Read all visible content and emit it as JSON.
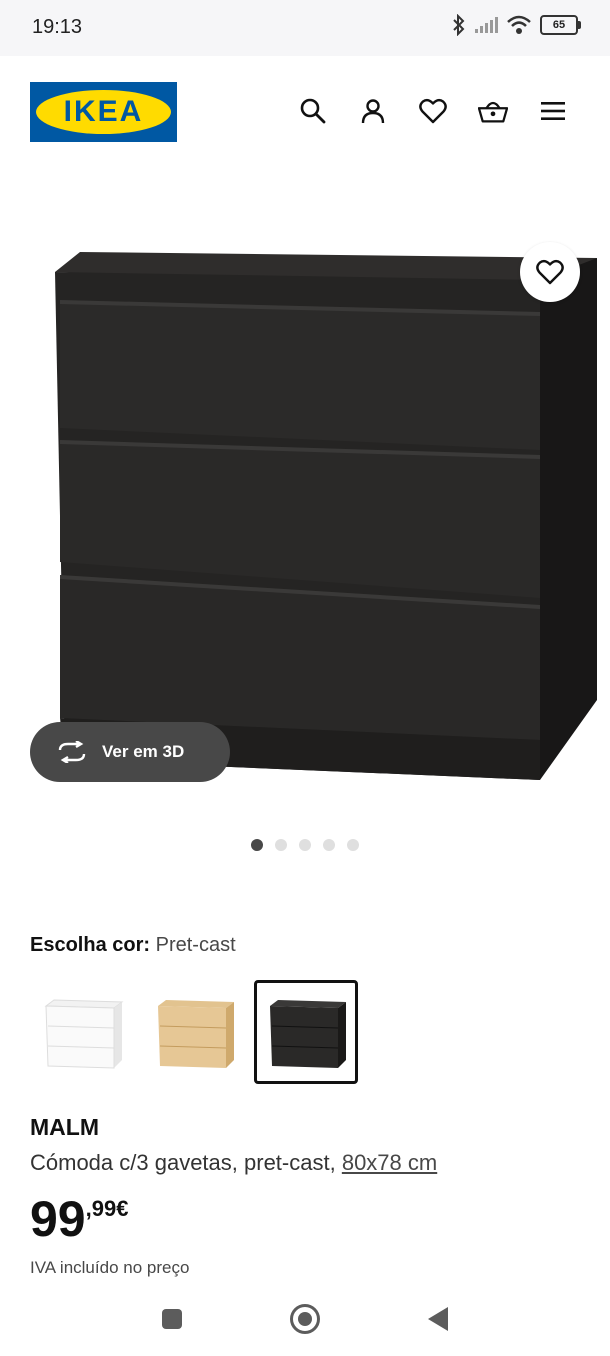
{
  "status_bar": {
    "time": "19:13",
    "battery": "65"
  },
  "header": {
    "logo_text": "IKEA",
    "icons": [
      "search-icon",
      "user-icon",
      "heart-icon",
      "basket-icon",
      "menu-icon"
    ]
  },
  "gallery": {
    "view_3d_label": "Ver em 3D",
    "image_count": 5,
    "active_index": 0
  },
  "color": {
    "label": "Escolha cor:",
    "value": "Pret-cast",
    "options": [
      "white",
      "oak",
      "black-brown"
    ],
    "selected_index": 2
  },
  "product": {
    "name": "MALM",
    "description": "Cómoda c/3 gavetas, pret-cast,",
    "dimensions": "80x78 cm",
    "price_int": "99",
    "price_dec": ",99€",
    "vat_note": "IVA incluído no preço"
  },
  "colors": {
    "brand_blue": "#0058a3",
    "brand_yellow": "#ffdb00",
    "dark_button": "#484848"
  }
}
